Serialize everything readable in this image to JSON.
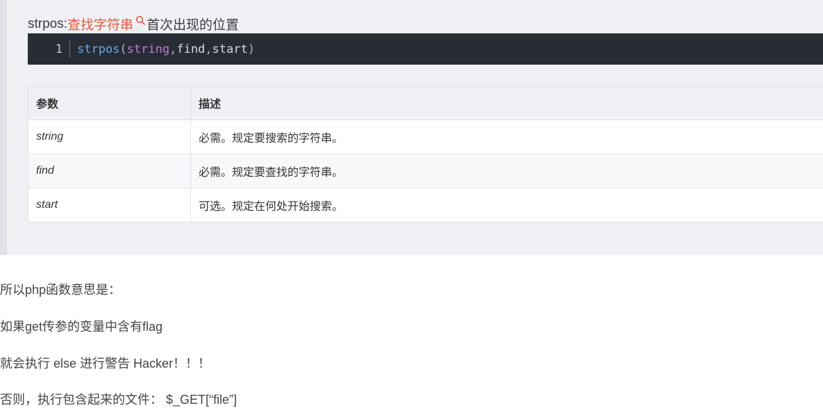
{
  "intro": {
    "prefix": "strpos: ",
    "link": "查找字符串",
    "icon": "search-icon",
    "suffix": "首次出现的位置"
  },
  "code": {
    "line_number": "1",
    "function": "strpos",
    "open_paren": "(",
    "arg1": "string",
    "comma1": ",",
    "arg2": "find",
    "comma2": ",",
    "arg3": "start",
    "close_paren": ")"
  },
  "table": {
    "headers": [
      "参数",
      "描述"
    ],
    "rows": [
      {
        "name": "string",
        "desc": "必需。规定要搜索的字符串。"
      },
      {
        "name": "find",
        "desc": "必需。规定要查找的字符串。"
      },
      {
        "name": "start",
        "desc": "可选。规定在何处开始搜索。"
      }
    ]
  },
  "paragraphs": [
    "所以php函数意思是：",
    "如果get传参的变量中含有flag",
    "就会执行 else 进行警告 Hacker！！！",
    "否则，执行包含起来的文件： $_GET[“file”]"
  ],
  "colors": {
    "link": "#e8593c",
    "code_bg": "#282c34",
    "function": "#61afef",
    "keyword_arg": "#c678dd",
    "quote_bg": "#eef0f4"
  }
}
